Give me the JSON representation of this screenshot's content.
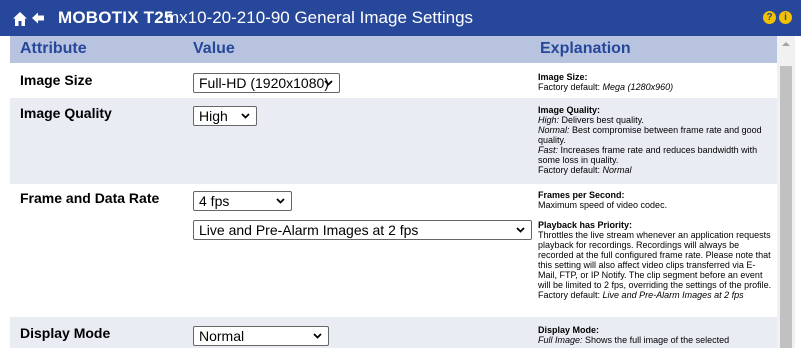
{
  "header": {
    "brand": "MOBOTIX T25",
    "title": "mx10-20-210-90 General Image Settings",
    "help_glyph": "?",
    "info_glyph": "i",
    "accent_color": "#26479a",
    "icon_color": "#f2c200",
    "icons": [
      "home-icon",
      "back-arrow-icon",
      "help-icon",
      "info-icon"
    ]
  },
  "columns": {
    "attribute": "Attribute",
    "value": "Value",
    "explanation": "Explanation"
  },
  "rows": [
    {
      "attribute": "Image Size",
      "value": "Full-HD (1920x1080)",
      "expl_title": "Image Size",
      "expl_line1_label": "Factory default:",
      "expl_line1_value": "Mega (1280x960)"
    },
    {
      "attribute": "Image Quality",
      "value": "High",
      "expl_title": "Image Quality",
      "high_label": "High:",
      "high_text": "Delivers best quality.",
      "normal_label": "Normal:",
      "normal_text": "Best compromise between frame rate and good quality.",
      "fast_label": "Fast:",
      "fast_text": "Increases frame rate and reduces bandwidth with some loss in quality.",
      "default_label": "Factory default:",
      "default_value": "Normal"
    },
    {
      "attribute": "Frame and Data Rate",
      "value": "4 fps",
      "value2": "Live and Pre-Alarm Images at 2 fps",
      "expl_title": "Frames per Second",
      "expl_text": "Maximum speed of video codec.",
      "expl2_title": "Playback has Priority",
      "expl2_text": "Throttles the live stream whenever an application requests playback for recordings. Recordings will always be recorded at the full configured frame rate. Please note that this setting will also affect video clips transferred via E-Mail, FTP, or IP Notify. The clip segment before an event will be limited to 2 fps, overriding the settings of the profile.",
      "default_label": "Factory default:",
      "default_value": "Live and Pre-Alarm Images at 2 fps"
    },
    {
      "attribute": "Display Mode",
      "value": "Normal",
      "expl_title": "Display Mode",
      "full_label": "Full Image:",
      "full_text": "Shows the full image of the selected"
    }
  ]
}
